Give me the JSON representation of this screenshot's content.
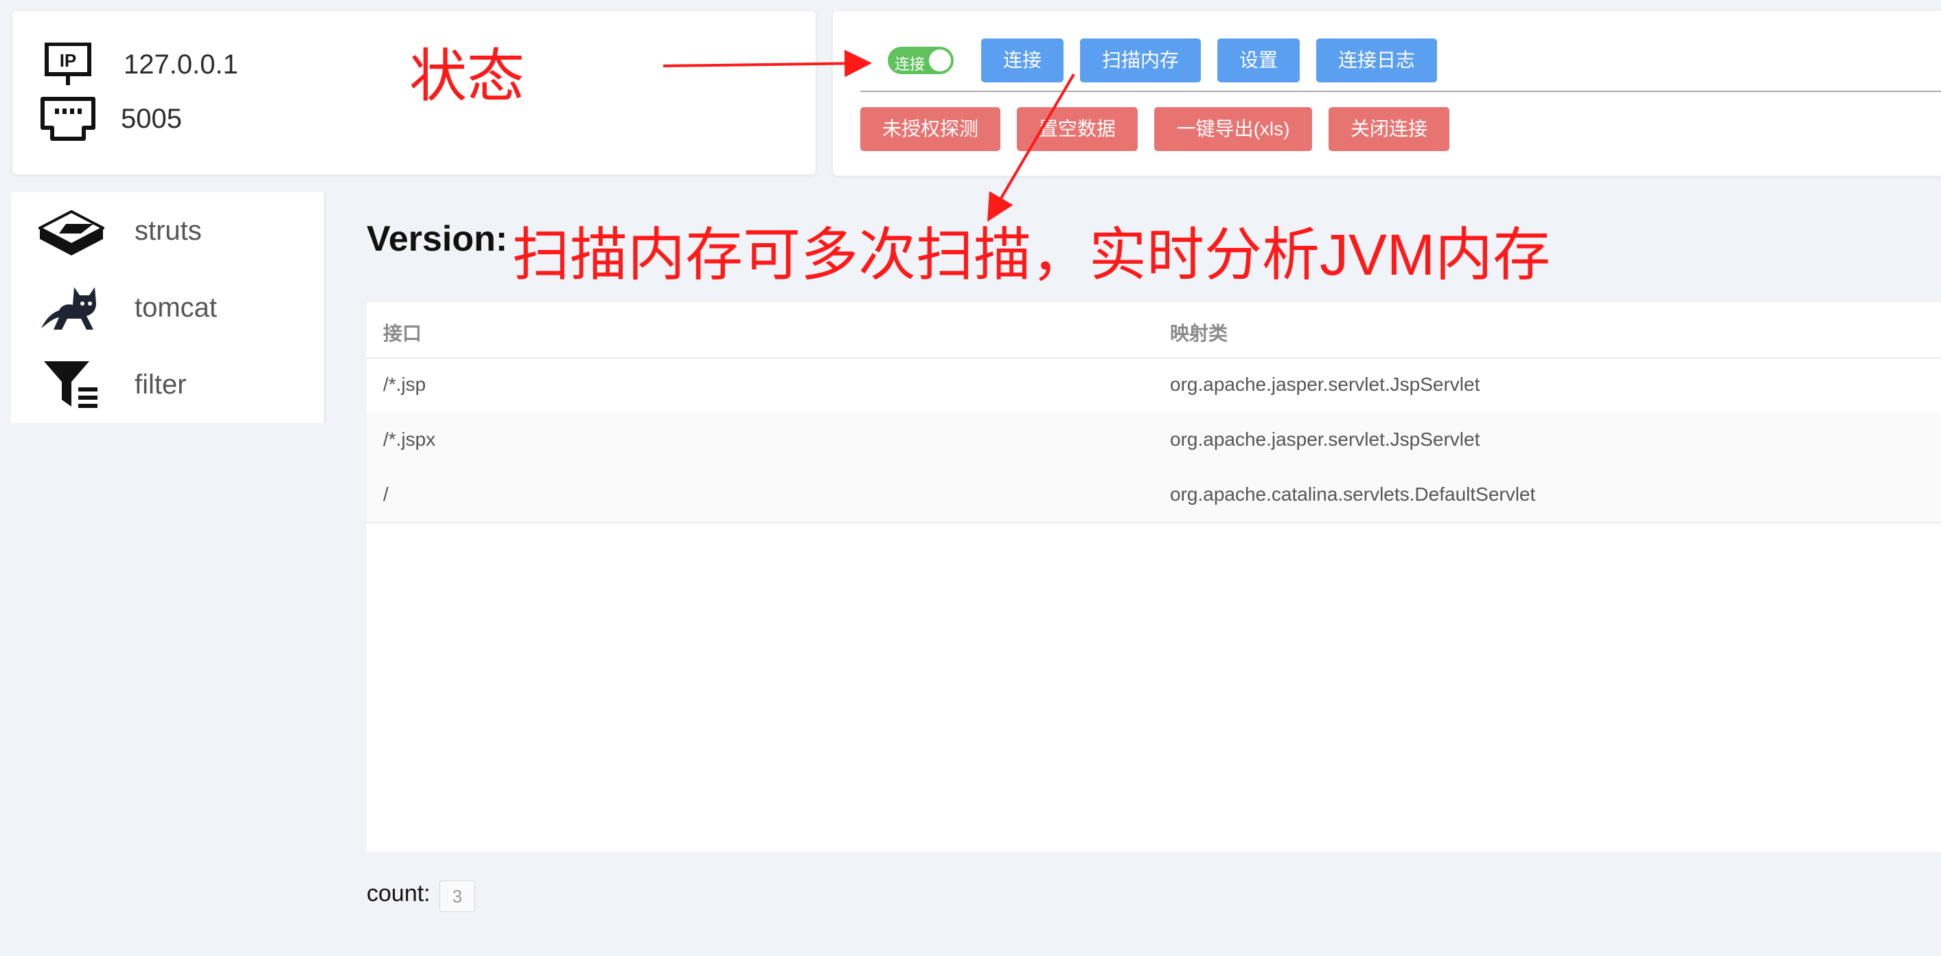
{
  "connection": {
    "ip": "127.0.0.1",
    "port": "5005"
  },
  "annotations": {
    "status": "状态",
    "scan": "扫描内存可多次扫描，实时分析JVM内存",
    "color": "#ff1a1a"
  },
  "controls": {
    "toggle_label": "连接",
    "toggle_on": true,
    "buttons_primary": [
      "连接",
      "扫描内存",
      "设置",
      "连接日志"
    ],
    "buttons_danger": [
      "未授权探测",
      "置空数据",
      "一键导出(xls)",
      "关闭连接"
    ],
    "colors": {
      "primary": "#5b9ff0",
      "danger": "#e77471",
      "toggle": "#5fc25d"
    }
  },
  "sidebar": {
    "items": [
      {
        "label": "struts",
        "icon": "struts-icon"
      },
      {
        "label": "tomcat",
        "icon": "tomcat-icon"
      },
      {
        "label": "filter",
        "icon": "filter-icon"
      }
    ]
  },
  "main": {
    "version_label": "Version:",
    "table": {
      "headers": [
        "接口",
        "映射类"
      ],
      "rows": [
        [
          "/*.jsp",
          "org.apache.jasper.servlet.JspServlet"
        ],
        [
          "/*.jspx",
          "org.apache.jasper.servlet.JspServlet"
        ],
        [
          "/",
          "org.apache.catalina.servlets.DefaultServlet"
        ]
      ]
    },
    "count_label": "count:",
    "count_value": "3"
  }
}
